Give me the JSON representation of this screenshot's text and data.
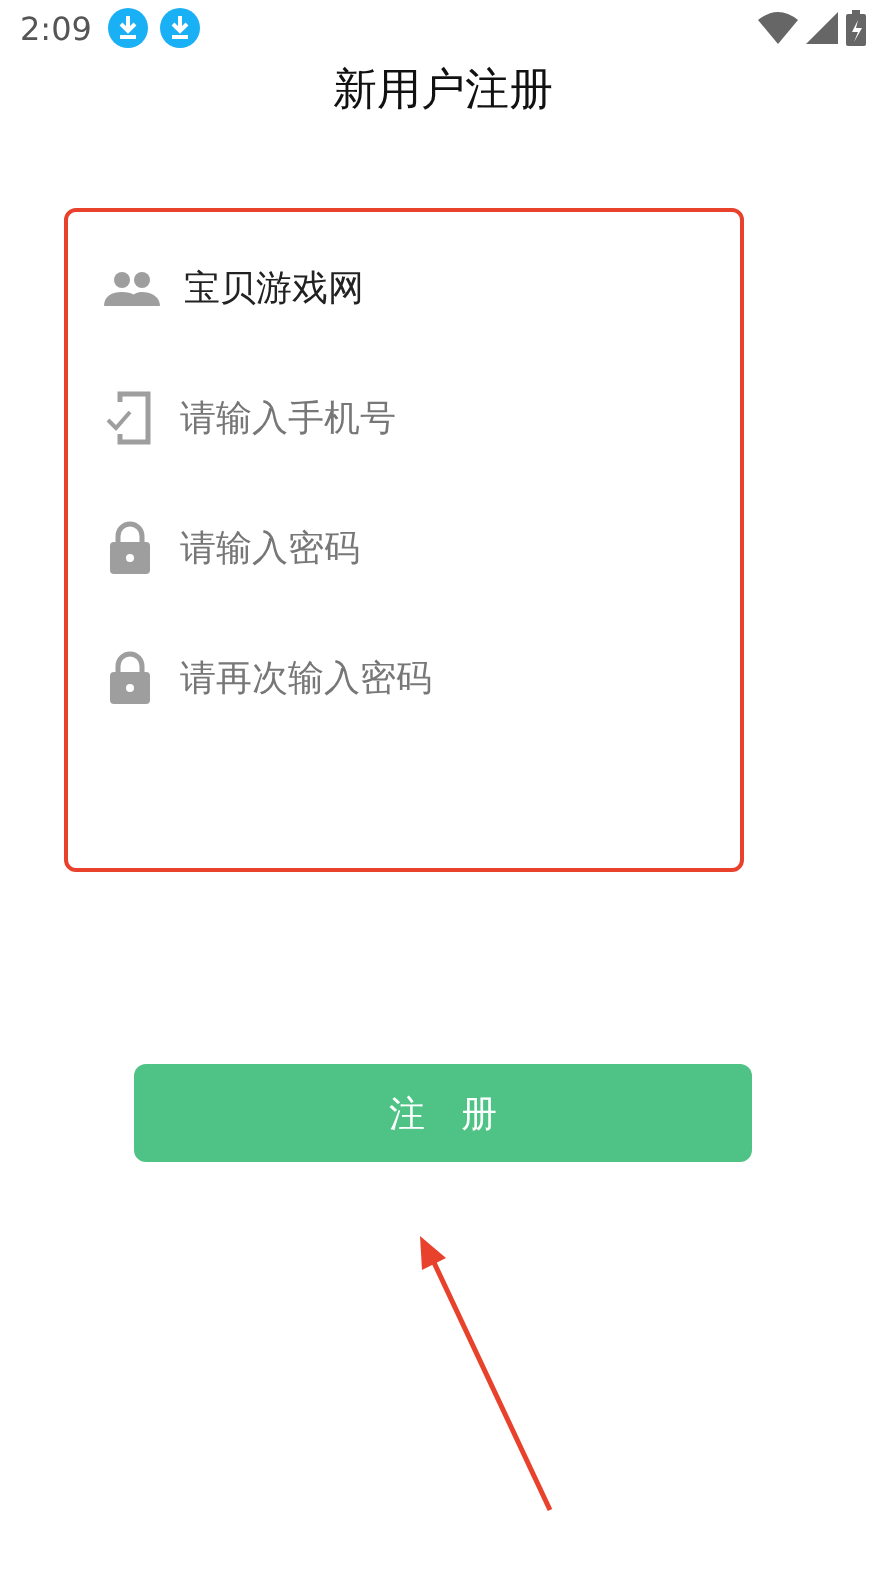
{
  "status_bar": {
    "time": "2:09",
    "notifications": [
      {
        "kind": "download"
      },
      {
        "kind": "download"
      }
    ]
  },
  "title": "新用户注册",
  "fields": [
    {
      "kind": "username",
      "value": "宝贝游戏网"
    },
    {
      "kind": "phone",
      "placeholder": "请输入手机号"
    },
    {
      "kind": "password",
      "placeholder": "请输入密码"
    },
    {
      "kind": "password",
      "placeholder": "请再次输入密码"
    }
  ],
  "submit": "注　册"
}
